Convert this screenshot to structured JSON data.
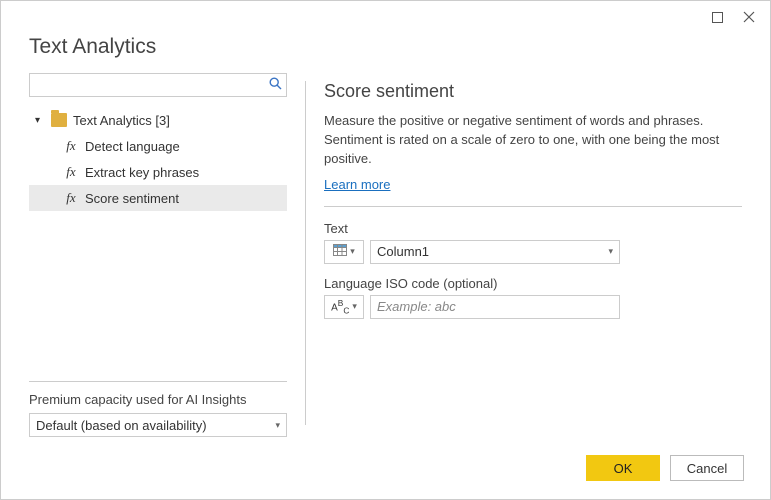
{
  "window": {
    "title": "Text Analytics"
  },
  "search": {
    "placeholder": ""
  },
  "tree": {
    "root": {
      "label": "Text Analytics [3]"
    },
    "items": [
      {
        "label": "Detect language"
      },
      {
        "label": "Extract key phrases"
      },
      {
        "label": "Score sentiment"
      }
    ]
  },
  "premium": {
    "label": "Premium capacity used for AI Insights",
    "selected": "Default (based on availability)"
  },
  "panel": {
    "title": "Score sentiment",
    "description": "Measure the positive or negative sentiment of words and phrases. Sentiment is rated on a scale of zero to one, with one being the most positive.",
    "learn_more": "Learn more",
    "text_label": "Text",
    "text_value": "Column1",
    "lang_label": "Language ISO code (optional)",
    "lang_placeholder": "Example: abc"
  },
  "footer": {
    "ok": "OK",
    "cancel": "Cancel"
  }
}
